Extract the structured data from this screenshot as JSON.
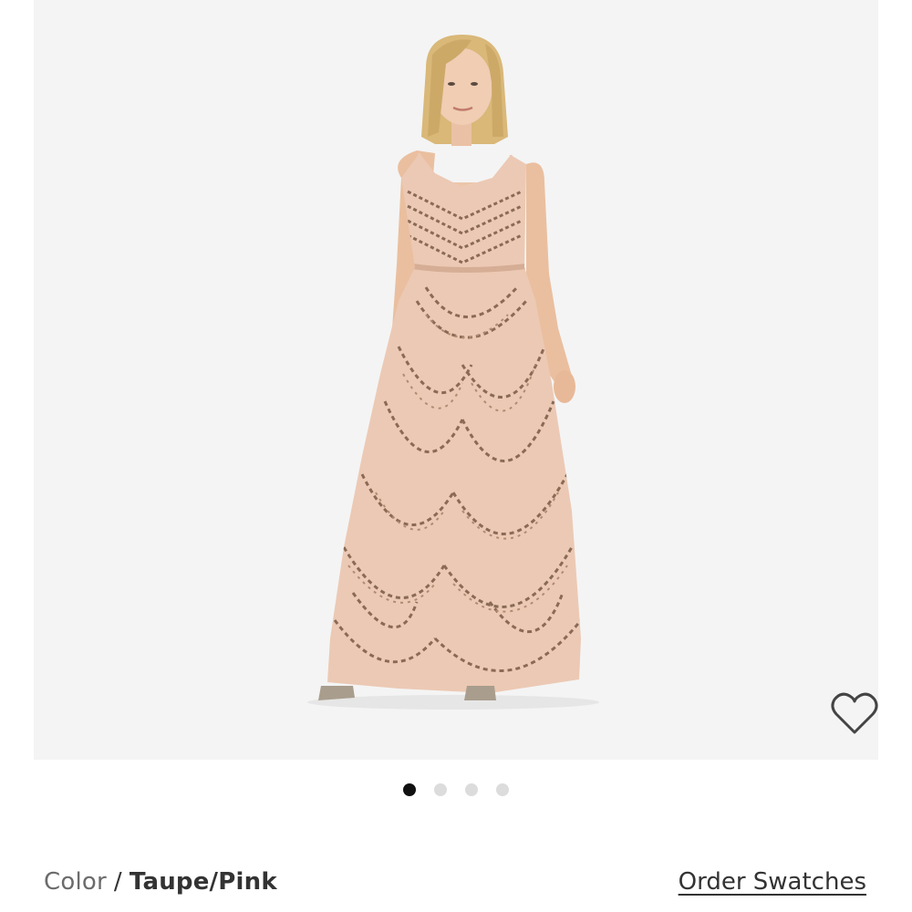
{
  "gallery": {
    "image_alt": "Beaded art deco blouson maxi dress",
    "slides": 4,
    "active_slide": 1
  },
  "product": {
    "color_label": "Color",
    "color_separator": "/",
    "color_value": "Taupe/Pink",
    "order_swatches_label": "Order Swatches"
  },
  "colors": {
    "gallery_bg": "#f4f4f4",
    "dress": "#ecc9b4",
    "beading": "#8a6a55",
    "active_dot": "#111111",
    "inactive_dot": "#dcdcdc",
    "text": "#333333"
  }
}
